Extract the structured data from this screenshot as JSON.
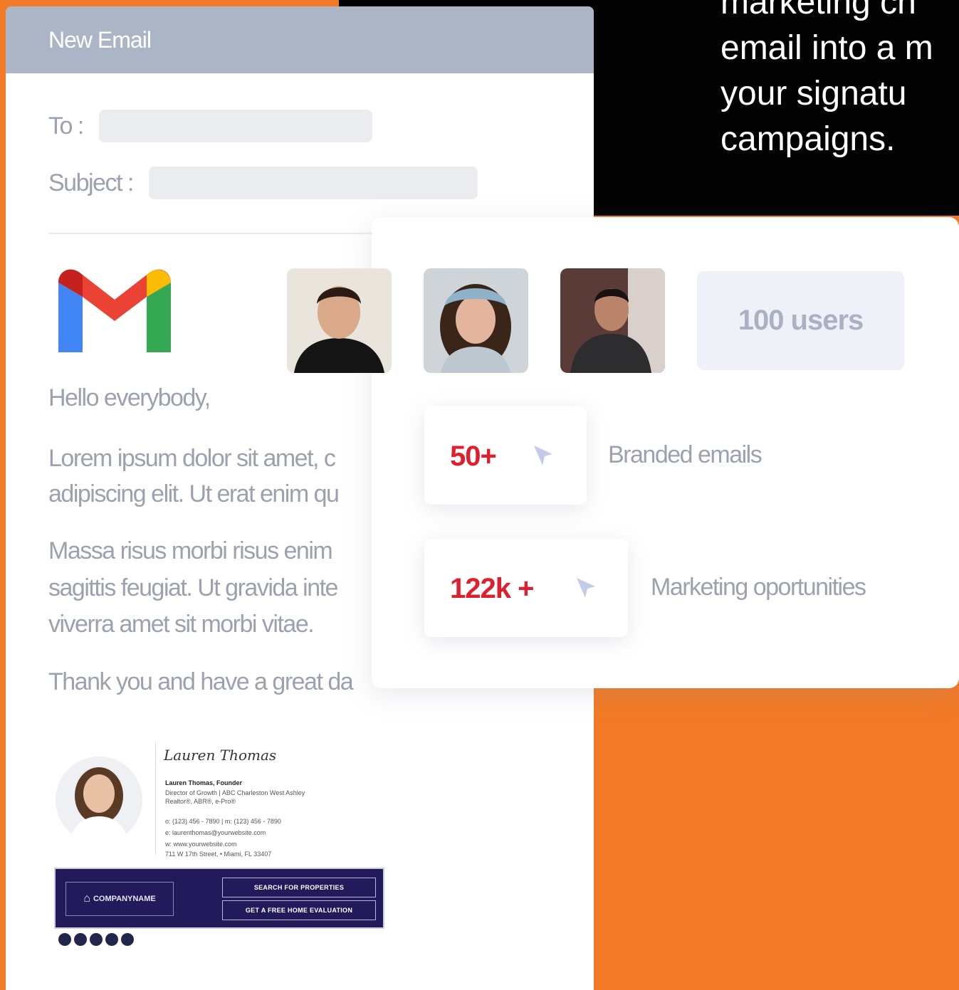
{
  "promo_text": [
    "marketing ch",
    "email into a m",
    "your signatu",
    "campaigns."
  ],
  "email": {
    "window_title": "New Email",
    "to_label": "To :",
    "subject_label": "Subject :",
    "greeting": "Hello everybody,",
    "paragraph1": [
      "Lorem ipsum dolor sit amet, c",
      "adipiscing elit. Ut erat enim qu"
    ],
    "paragraph2": [
      "Massa risus morbi risus enim",
      "sagittis feugiat. Ut gravida inte",
      "viverra amet sit morbi vitae."
    ],
    "closing": "Thank you and have a great da"
  },
  "signature": {
    "script_name": "Lauren Thomas",
    "name_title": "Lauren Thomas, Founder",
    "role_line1": "Director of Growth | ABC Charleston West Ashley",
    "role_line2": "Realtor®, ABR®, e-Pro®",
    "phones": "o: (123) 456 - 7890  |  m: (123) 456 - 7890",
    "email": "e: laurenthomas@yourwebsite.com",
    "website": "w: www.yourwebsite.com",
    "address": "711 W 17th Street, • Miami, FL 33407",
    "company": "COMPANYNAME",
    "button1": "SEARCH FOR PROPERTIES",
    "button2": "GET A FREE HOME EVALUATION"
  },
  "stats": {
    "users_label": "100 users",
    "stat1_value": "50+",
    "stat1_label": "Branded emails",
    "stat2_value": "122k +",
    "stat2_label": "Marketing oportunities"
  },
  "colors": {
    "orange": "#f27a26",
    "black": "#030303",
    "header_gray": "#acb5c6",
    "accent_red": "#e01f2d",
    "text_gray": "#9ba2ae"
  }
}
